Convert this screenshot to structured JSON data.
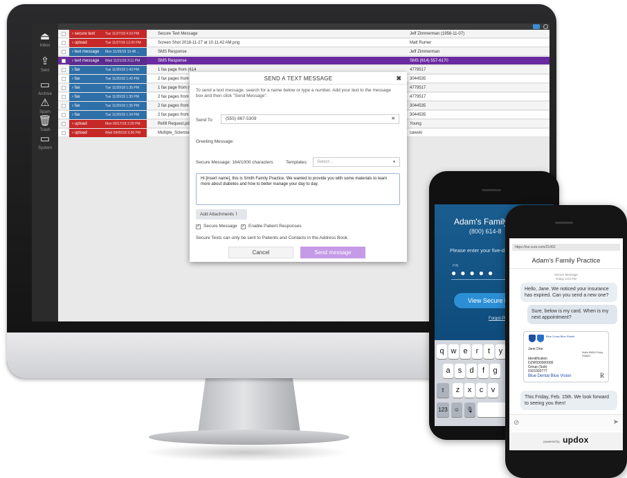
{
  "sidebar": {
    "items": [
      {
        "icon": "inbox-icon",
        "label": "Inbox"
      },
      {
        "icon": "sent-icon",
        "label": "Sent"
      },
      {
        "icon": "archive-icon",
        "label": "Archive"
      },
      {
        "icon": "spam-icon",
        "label": "Spam"
      },
      {
        "icon": "trash-icon",
        "label": "Trash"
      },
      {
        "icon": "system-icon",
        "label": "System"
      }
    ]
  },
  "messages": [
    {
      "type": "secure text",
      "color": "red",
      "date": "Tue 11/27/18 4:10 PM",
      "subject": "Secure Text Message",
      "from": "Jeff Zimmerman (1956-11-07)"
    },
    {
      "type": "upload",
      "color": "red",
      "date": "Tue 11/27/18 12:20 PM",
      "subject": "Screen Shot 2018-11-27 at 10.11.42 AM.png",
      "from": "Matt Rumer"
    },
    {
      "type": "text message",
      "color": "blue",
      "date": "Mon 11/26/18 10:48 ...",
      "subject": "SMS Response",
      "from": "Jeff Zimmerman"
    },
    {
      "type": "text message",
      "color": "purple",
      "date": "Wed 11/21/18 3:11 PM",
      "subject": "SMS Response",
      "from": "SMS (614) 557-6170",
      "selected": true
    },
    {
      "type": "fax",
      "color": "blue",
      "date": "Tue 11/20/18 1:43 PM",
      "subject": "1 fax page from (614",
      "from": "4779517"
    },
    {
      "type": "fax",
      "color": "blue",
      "date": "Tue 11/20/18 1:42 PM",
      "subject": "2 fax pages from (888",
      "from": "3044535"
    },
    {
      "type": "fax",
      "color": "blue",
      "date": "Tue 11/20/18 1:35 PM",
      "subject": "1 fax page from (614",
      "from": "4779517"
    },
    {
      "type": "fax",
      "color": "blue",
      "date": "Tue 11/20/18 1:35 PM",
      "subject": "2 fax pages from (888",
      "from": "4779517"
    },
    {
      "type": "fax",
      "color": "blue",
      "date": "Tue 11/20/18 1:35 PM",
      "subject": "2 fax pages from (888",
      "from": "3044535"
    },
    {
      "type": "fax",
      "color": "blue",
      "date": "Tue 11/20/18 1:34 PM",
      "subject": "2 fax pages from (888",
      "from": "3044535"
    },
    {
      "type": "upload",
      "color": "red",
      "date": "Mon 09/17/18 2:29 PM",
      "subject": "Refill Request.pdf",
      "from": "Young"
    },
    {
      "type": "upload",
      "color": "red",
      "date": "Wed 09/05/18 3:36 PM",
      "subject": "Multiple_Sclerosis_Ed",
      "from": "cawski"
    }
  ],
  "dialog": {
    "title": "SEND A TEXT MESSAGE",
    "close": "✖",
    "intro": "To send a text message, search for a name below or type a number. Add your text to the message box and then click \"Send Message\".",
    "send_to_label": "Send To",
    "send_to_value": "(555) 867-5309",
    "greeting_label": "Greeting Message:",
    "secure_label": "Secure Message: 164/1000 characters",
    "templates_label": "Templates:",
    "templates_placeholder": "Select...",
    "message_text": "Hi [insert name], this is Smith Family Practice. We wanted to provide you with some materials to learn more about diabetes and how to better manage your day to day.",
    "attach_label": "Add Attachments",
    "secure_cb_label": "Secure Message",
    "responses_cb_label": "Enable Patient Responses",
    "note": "Secure Texts can only be sent to Patients and Contacts in the Address Book.",
    "cancel_label": "Cancel",
    "send_label": "Send message",
    "send_color": "#c59ae6"
  },
  "phone_back": {
    "title": "Adam's Family",
    "phone": "(800) 614-8",
    "prompt": "Please enter your five-d",
    "pin_label": "PIN",
    "pin_dots": "●●●●●",
    "view_button": "View Secure M",
    "forgot": "Forgot PIN",
    "keys_row1": [
      "q",
      "w",
      "e",
      "r",
      "t",
      "y"
    ],
    "keys_row2": [
      "a",
      "s",
      "d",
      "f",
      "g"
    ],
    "keys_row3": [
      "z",
      "x",
      "c",
      "v"
    ],
    "shift_key": "⇧",
    "num_key": "123",
    "emoji_key": "☺",
    "mic_key": "🎙",
    "space_key": "spac"
  },
  "phone_front": {
    "url": "https://ise.cure.com/21452",
    "title": "Adam's Family Practice",
    "meta_type": "Secure Message",
    "meta_time": "Today 3:04 PM",
    "msg1": "Hello, Jane. We noticed your insurance has expired. Can you send a new one?",
    "msg2": "Sure, below is my card. When is my next appointment?",
    "card_brand": "Blue Cross Blue Shield",
    "card_name": "Jane Doe",
    "card_id_label": "Identification",
    "card_id": "DZW930000000",
    "card_group_label": "Group (Sub)",
    "card_group": "0101003777",
    "card_right": "Suffix 906D0 Policy PA9823",
    "card_footer": "Blue Dental  Blue Vision",
    "card_rx": "R",
    "msg3": "This Friday, Feb. 15th. We look forward to seeing you then!",
    "powered": "powered by",
    "logo": "updox"
  }
}
